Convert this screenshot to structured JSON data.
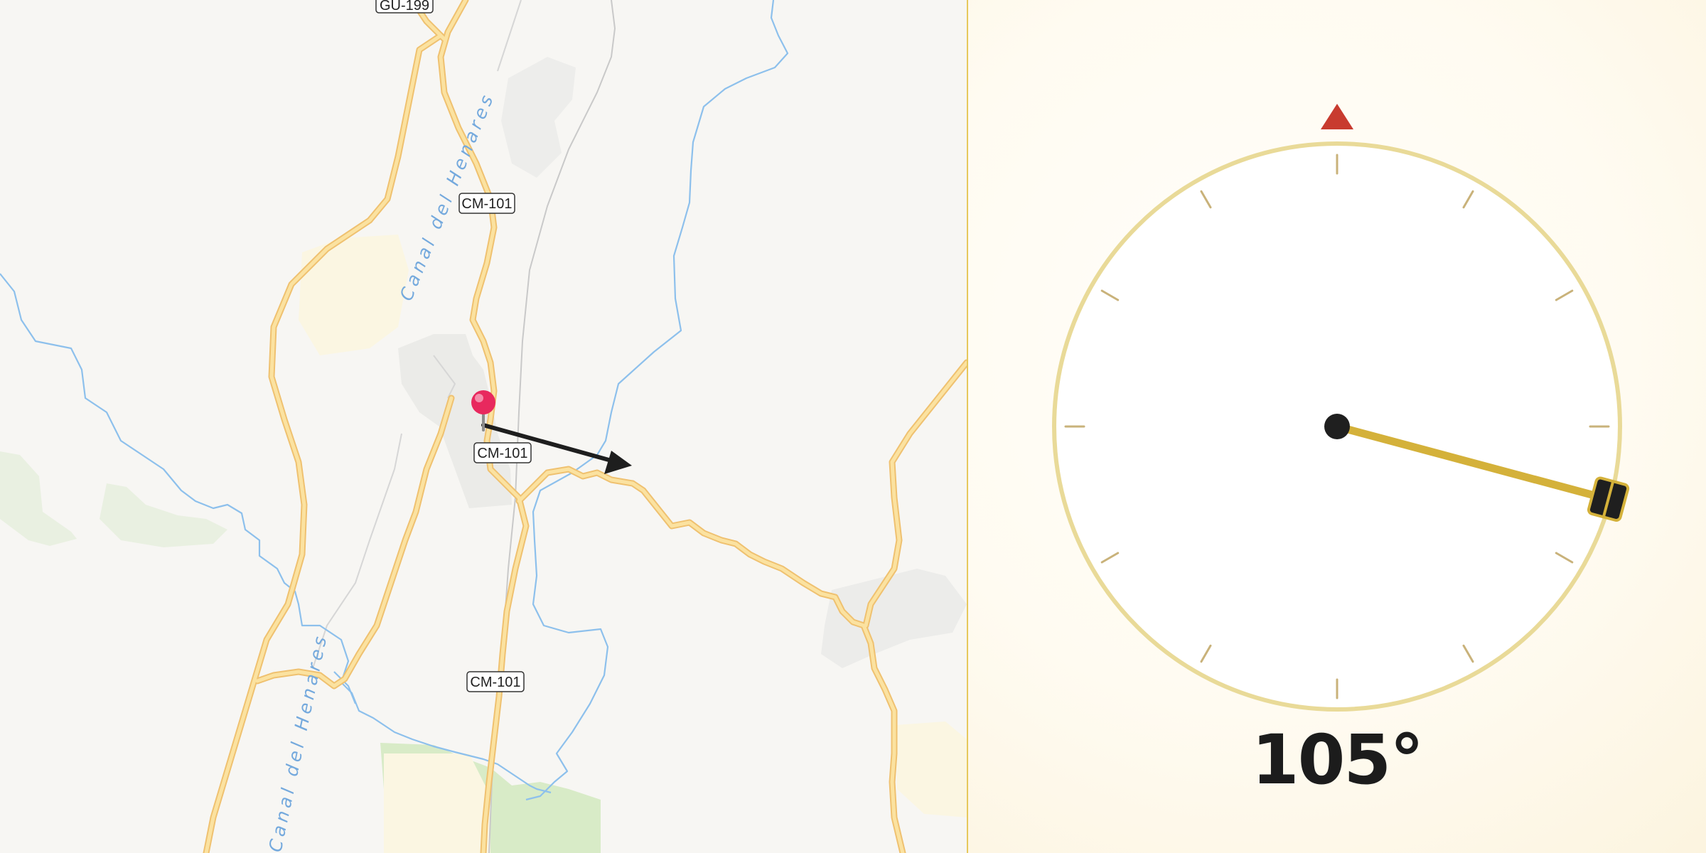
{
  "map": {
    "road_labels": [
      "GU-199",
      "CM-101",
      "CM-101",
      "CM-101"
    ],
    "water_labels": [
      "Canal del Henares",
      "Canal del Henares"
    ],
    "colors": {
      "background": "#f7f6f3",
      "road_fill": "#fbe2a0",
      "road_casing": "#efc170",
      "water": "#8dc0ec",
      "urban": "#ecebe8",
      "vegetation": "#dcebcc",
      "pin": "#e8295e",
      "arrow": "#1e1e1e"
    }
  },
  "compass": {
    "heading_degrees": 105,
    "heading_text": "105°",
    "colors": {
      "ring": "#e9da98",
      "tick": "#c9b27a",
      "north_marker": "#c83b2f",
      "needle": "#d4b13a",
      "hub": "#1f1f1f",
      "background": "#fffbf1"
    }
  }
}
